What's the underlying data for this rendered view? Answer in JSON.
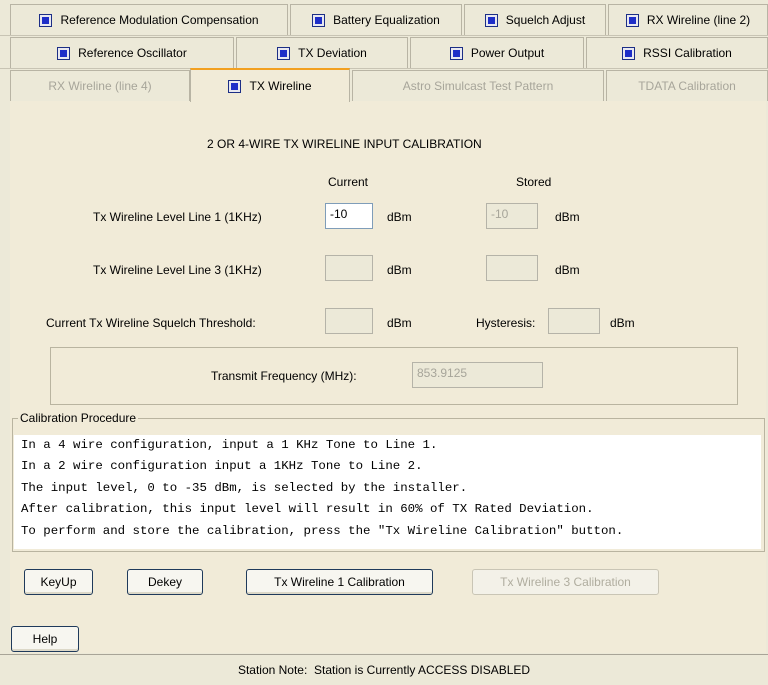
{
  "tabs": {
    "row1": [
      {
        "label": "Reference Modulation Compensation"
      },
      {
        "label": "Battery Equalization"
      },
      {
        "label": "Squelch Adjust"
      },
      {
        "label": "RX Wireline (line 2)"
      }
    ],
    "row2": [
      {
        "label": "Reference Oscillator"
      },
      {
        "label": "TX Deviation"
      },
      {
        "label": "Power Output"
      },
      {
        "label": "RSSI Calibration"
      }
    ],
    "row3": [
      {
        "label": "RX Wireline (line 4)"
      },
      {
        "label": "TX Wireline"
      },
      {
        "label": "Astro Simulcast Test Pattern"
      },
      {
        "label": "TDATA Calibration"
      }
    ]
  },
  "heading": "2 OR 4-WIRE TX WIRELINE INPUT CALIBRATION",
  "columns": {
    "current": "Current",
    "stored": "Stored"
  },
  "rows": {
    "line1": {
      "label": "Tx Wireline Level Line 1 (1KHz)",
      "current": "-10",
      "stored": "-10",
      "unit": "dBm"
    },
    "line3": {
      "label": "Tx Wireline Level Line 3 (1KHz)",
      "current": "",
      "stored": "",
      "unit": "dBm"
    },
    "squelch": {
      "label": "Current Tx Wireline Squelch Threshold:",
      "current": "",
      "unit": "dBm",
      "hysteresis_label": "Hysteresis:",
      "hysteresis": "",
      "hysteresis_unit": "dBm"
    }
  },
  "frequency": {
    "label": "Transmit Frequency (MHz):",
    "value": "853.9125"
  },
  "procedure": {
    "title": "Calibration Procedure",
    "lines": [
      "In a 4 wire configuration, input a 1 KHz Tone to Line 1.",
      "In a 2 wire configuration input a 1KHz Tone to Line 2.",
      "The input level, 0 to -35 dBm, is selected by the installer.",
      "After calibration, this input level will result in 60% of TX Rated Deviation.",
      "To perform and store the calibration, press the \"Tx Wireline Calibration\" button."
    ]
  },
  "buttons": {
    "keyup": "KeyUp",
    "dekey": "Dekey",
    "cal1": "Tx Wireline 1 Calibration",
    "cal3": "Tx Wireline 3 Calibration",
    "help": "Help"
  },
  "status": "Station Note:  Station is Currently ACCESS DISABLED",
  "colors": {
    "checkbox": "#1e2ec8",
    "selected_tab_accent": "#f2a020",
    "panel": "#f1ebd8",
    "window": "#ece9d8"
  }
}
